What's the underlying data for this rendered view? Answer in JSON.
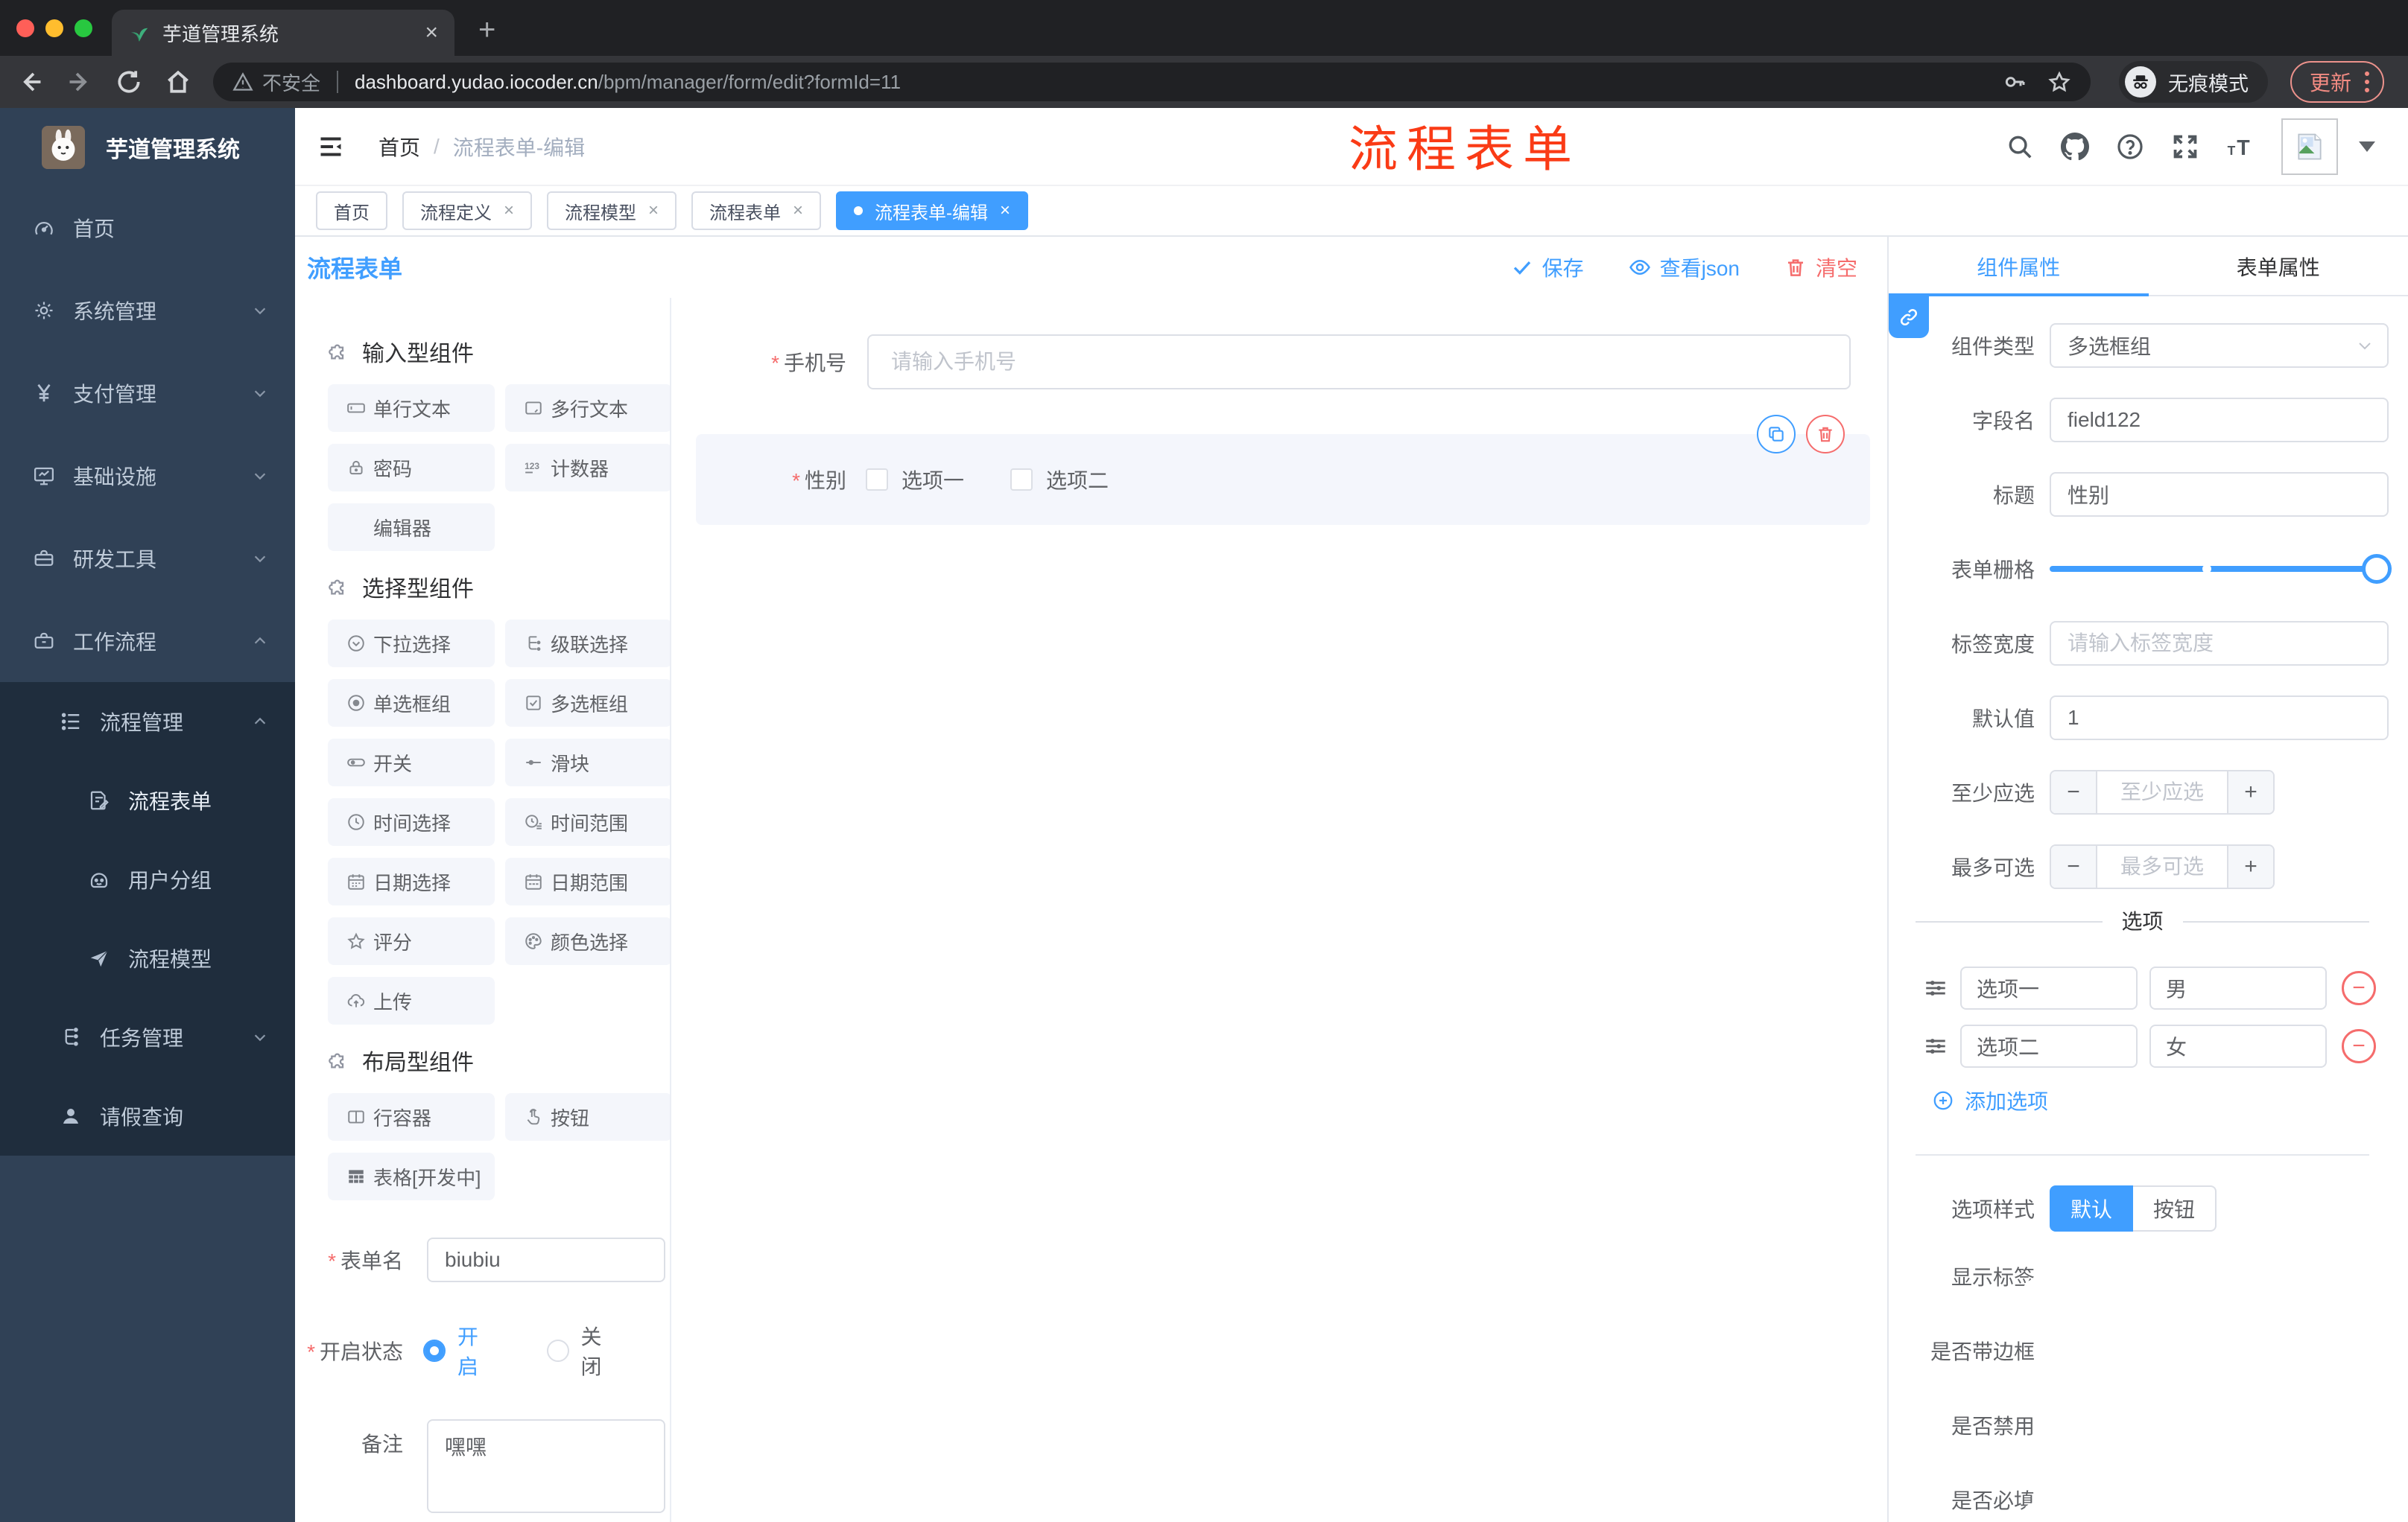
{
  "ui": {
    "close": "×",
    "plus": "+",
    "minus": "−",
    "slash": "/"
  },
  "colors": {
    "accent": "#409eff",
    "danger": "#f56c6c",
    "annotation": "#fa3b16"
  },
  "browser": {
    "tab_title": "芋道管理系统",
    "security": "不安全",
    "url_host": "dashboard.yudao.iocoder.cn",
    "url_path": "/bpm/manager/form/edit?formId=11",
    "incognito": "无痕模式",
    "update": "更新"
  },
  "sidebar": {
    "title": "芋道管理系统",
    "items": [
      {
        "label": "首页"
      },
      {
        "label": "系统管理"
      },
      {
        "label": "支付管理"
      },
      {
        "label": "基础设施"
      },
      {
        "label": "研发工具"
      },
      {
        "label": "工作流程"
      }
    ],
    "submenu": {
      "group": {
        "label": "流程管理"
      },
      "children": [
        {
          "label": "流程表单"
        },
        {
          "label": "用户分组"
        },
        {
          "label": "流程模型"
        }
      ],
      "tail": [
        {
          "label": "任务管理"
        },
        {
          "label": "请假查询"
        }
      ]
    }
  },
  "header": {
    "breadcrumb": [
      "首页",
      "流程表单-编辑"
    ],
    "annotation": "流程表单"
  },
  "tags": [
    {
      "label": "首页"
    },
    {
      "label": "流程定义"
    },
    {
      "label": "流程模型"
    },
    {
      "label": "流程表单"
    },
    {
      "label": "流程表单-编辑"
    }
  ],
  "designer": {
    "title": "流程表单",
    "actions": {
      "save": "保存",
      "view_json": "查看json",
      "clear": "清空"
    },
    "palette": {
      "sections": [
        {
          "title": "输入型组件",
          "items": [
            "单行文本",
            "多行文本",
            "密码",
            "计数器",
            "编辑器"
          ]
        },
        {
          "title": "选择型组件",
          "items": [
            "下拉选择",
            "级联选择",
            "单选框组",
            "多选框组",
            "开关",
            "滑块",
            "时间选择",
            "时间范围",
            "日期选择",
            "日期范围",
            "评分",
            "颜色选择",
            "上传"
          ]
        },
        {
          "title": "布局型组件",
          "items": [
            "行容器",
            "按钮",
            "表格[开发中]"
          ]
        }
      ]
    },
    "form": {
      "name_label": "表单名",
      "name_value": "biubiu",
      "status_label": "开启状态",
      "status_on": "开启",
      "status_off": "关闭",
      "remark_label": "备注",
      "remark_value": "嘿嘿"
    }
  },
  "canvas": {
    "phone": {
      "label": "手机号",
      "placeholder": "请输入手机号"
    },
    "gender": {
      "label": "性别",
      "options": [
        "选项一",
        "选项二"
      ]
    }
  },
  "panel": {
    "tabs": [
      "组件属性",
      "表单属性"
    ],
    "fields": {
      "type_label": "组件类型",
      "type_value": "多选框组",
      "field_label": "字段名",
      "field_value": "field122",
      "title_label": "标题",
      "title_value": "性别",
      "grid_label": "表单栅格",
      "labelwidth_label": "标签宽度",
      "labelwidth_placeholder": "请输入标签宽度",
      "default_label": "默认值",
      "default_value": "1",
      "min_label": "至少应选",
      "min_placeholder": "至少应选",
      "max_label": "最多可选",
      "max_placeholder": "最多可选"
    },
    "options": {
      "divider": "选项",
      "rows": [
        {
          "label": "选项一",
          "value": "男"
        },
        {
          "label": "选项二",
          "value": "女"
        }
      ],
      "add": "添加选项"
    },
    "style": {
      "label": "选项样式",
      "default": "默认",
      "button": "按钮"
    },
    "switches": [
      {
        "label": "显示标签"
      },
      {
        "label": "是否带边框"
      },
      {
        "label": "是否禁用"
      },
      {
        "label": "是否必填"
      }
    ]
  }
}
